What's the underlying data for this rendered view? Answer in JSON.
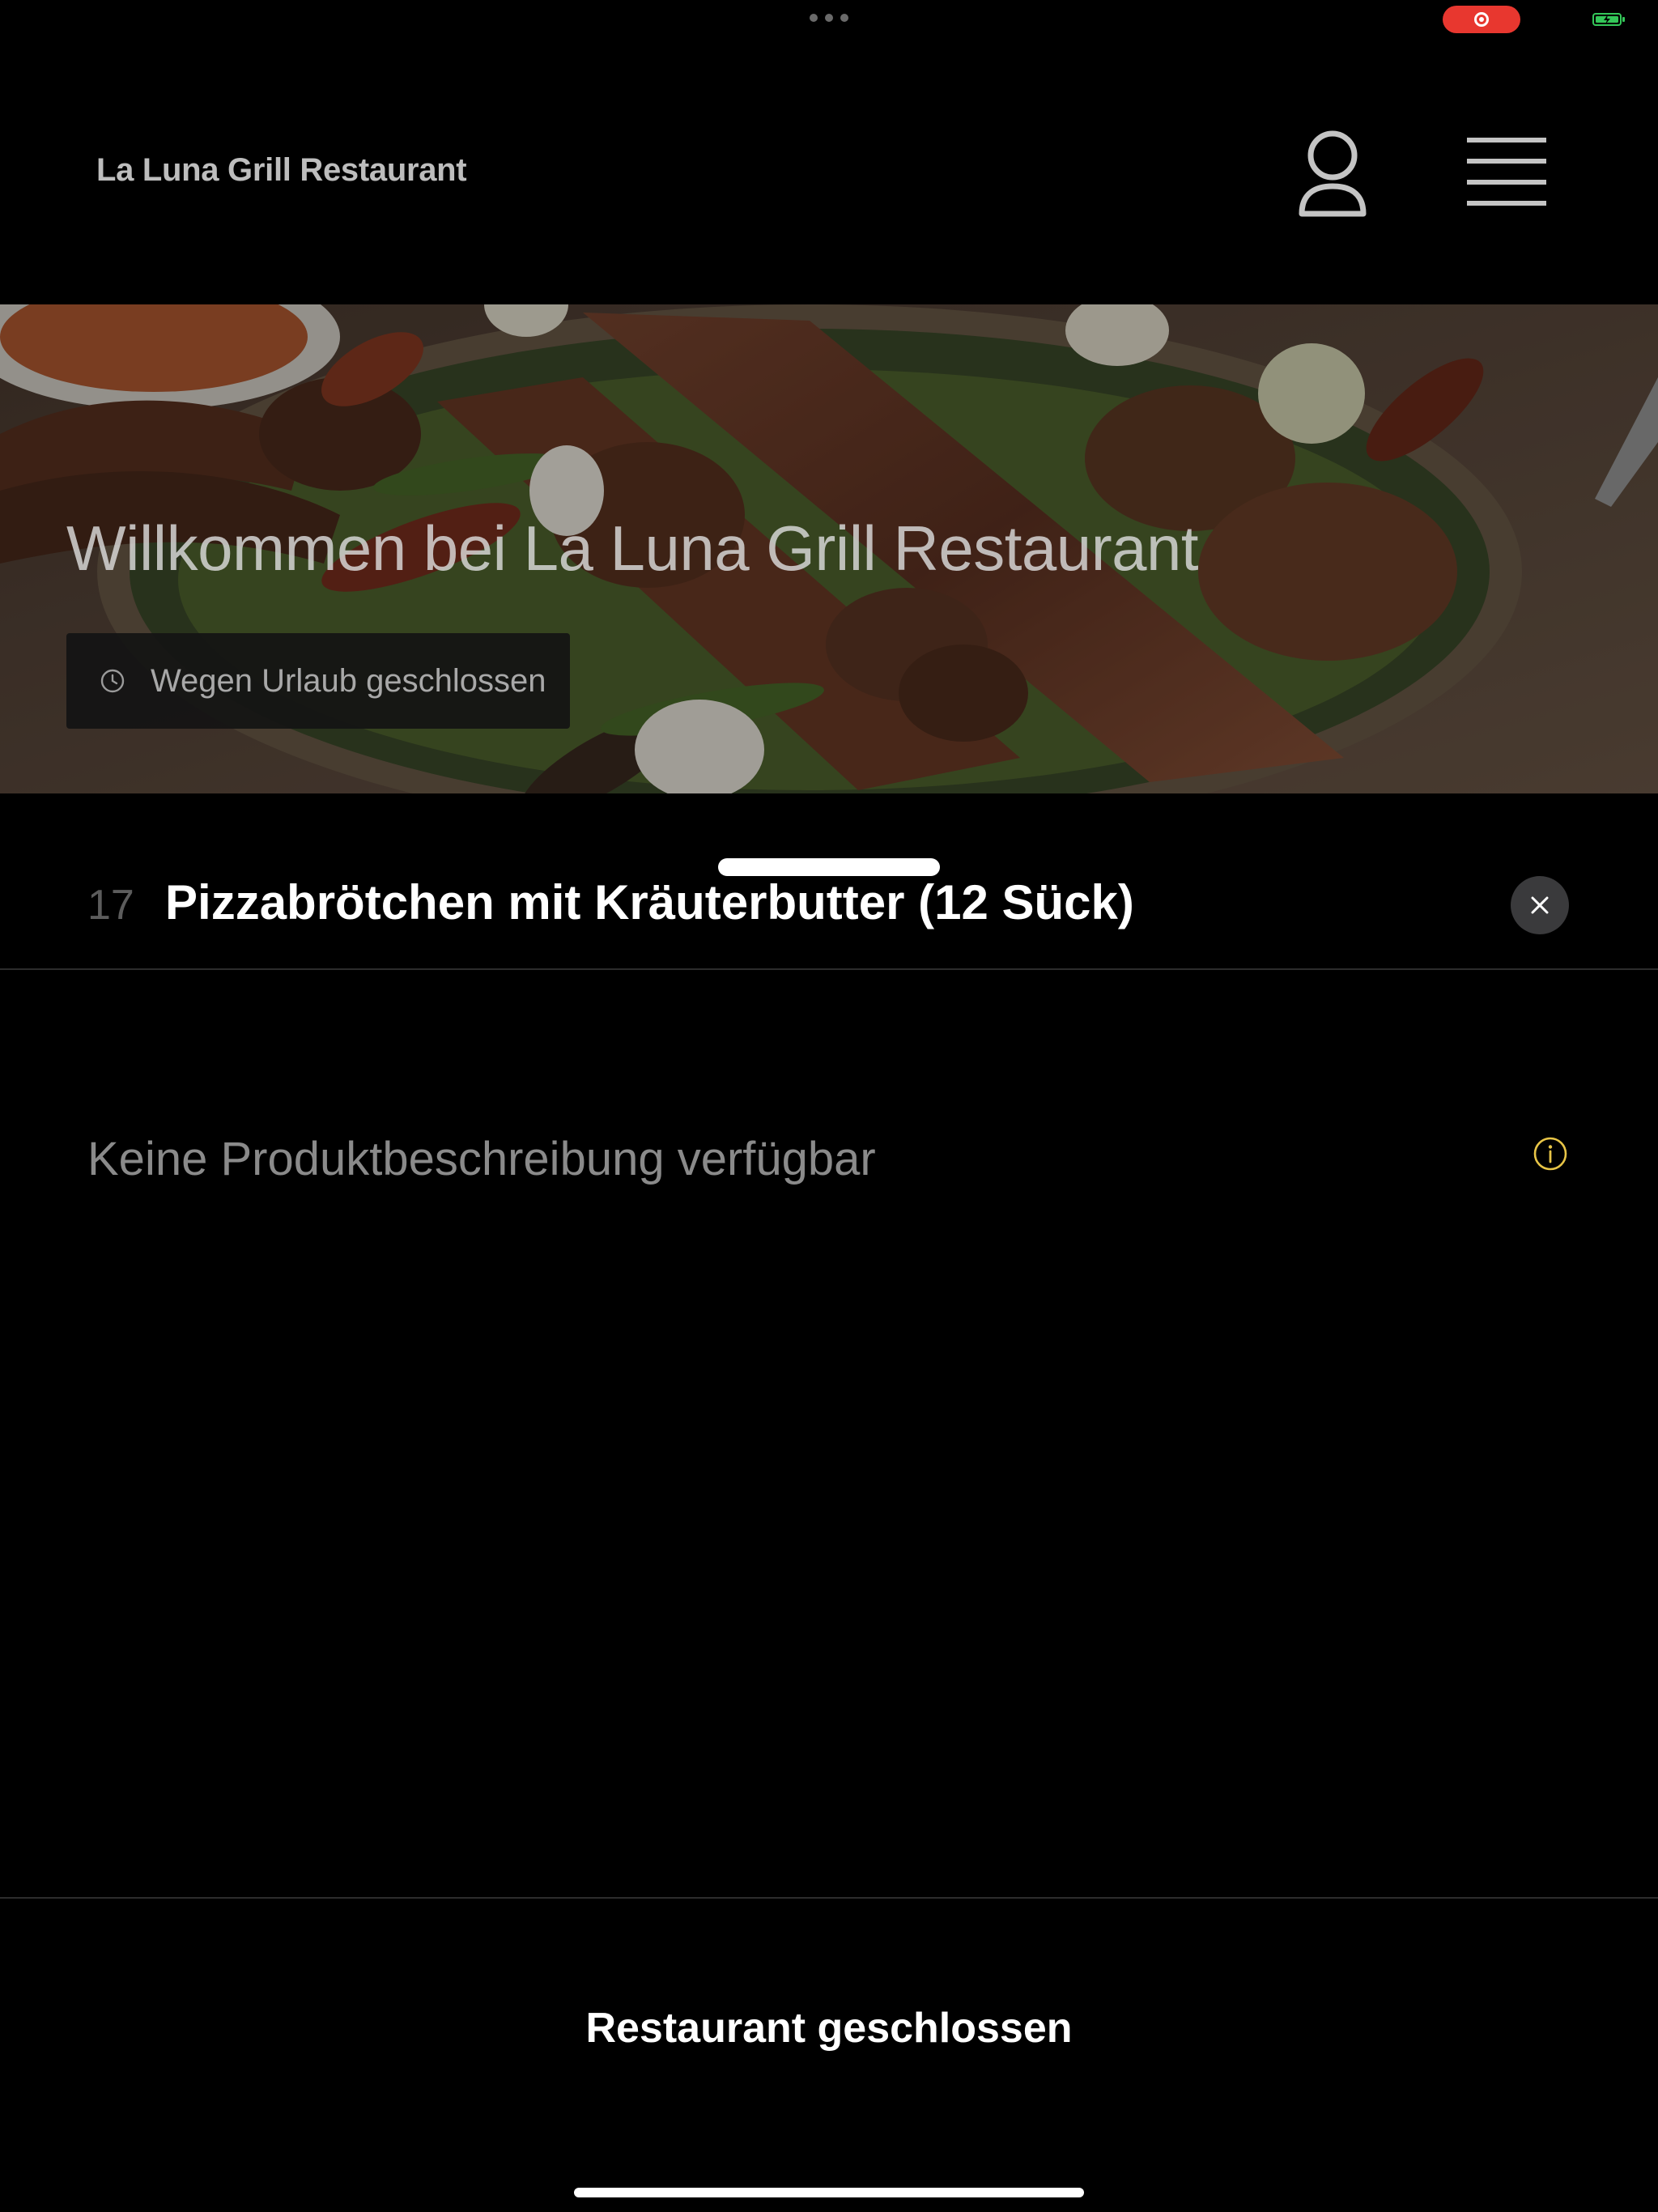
{
  "header": {
    "restaurant_name": "La Luna Grill Restaurant"
  },
  "hero": {
    "title": "Willkommen bei La Luna Grill Restaurant",
    "status_badge": "Wegen Urlaub geschlossen"
  },
  "product": {
    "number": "17",
    "name": "Pizzabrötchen mit Kräuterbutter (12 Sück)",
    "description": "Keine Produktbeschreibung verfügbar"
  },
  "footer": {
    "status": "Restaurant geschlossen"
  },
  "colors": {
    "background": "#000000",
    "recording": "#e8372f",
    "battery": "#34c759",
    "info_accent": "#e8c547",
    "muted_text": "#8a8a8a"
  },
  "icons": {
    "account": "person-outline-icon",
    "menu": "hamburger-menu-icon",
    "clock": "clock-icon",
    "close": "close-icon",
    "info": "info-icon"
  }
}
